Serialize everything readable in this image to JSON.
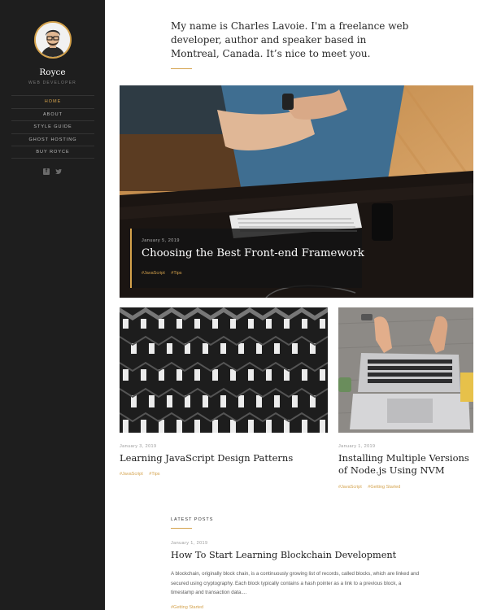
{
  "sidebar": {
    "site_name": "Royce",
    "site_description": "WEB DEVELOPER",
    "nav": [
      {
        "label": "HOME"
      },
      {
        "label": "ABOUT"
      },
      {
        "label": "STYLE GUIDE"
      },
      {
        "label": "GHOST HOSTING"
      },
      {
        "label": "BUY ROYCE"
      }
    ],
    "social": [
      "facebook-icon",
      "twitter-icon"
    ]
  },
  "intro": {
    "text": "My name is Charles Lavoie. I'm a freelance web developer, author and speaker based in Montreal, Canada. It’s nice to meet you."
  },
  "featured": {
    "date": "January 5, 2019",
    "title": "Choosing the Best Front-end Framework",
    "tags": [
      "#JavaScript",
      "#Tips"
    ]
  },
  "posts": [
    {
      "date": "January 3, 2019",
      "title": "Learning JavaScript Design Patterns",
      "tags": [
        "#JavaScript",
        "#Tips"
      ]
    },
    {
      "date": "January 1, 2019",
      "title": "Installing Multiple Versions of Node.js Using NVM",
      "tags": [
        "#JavaScript",
        "#Getting Started"
      ]
    }
  ],
  "latest": {
    "label": "LATEST POSTS",
    "date": "January 1, 2019",
    "title": "How To Start Learning Blockchain Development",
    "excerpt": "A blockchain, originally block chain, is a continuously growing list of records, called blocks, which are linked and secured using cryptography. Each block typically contains a hash pointer as a link to a previous block, a timestamp and transaction data....",
    "tag": "#Getting Started"
  },
  "colors": {
    "accent": "#d4a24c",
    "sidebar_bg": "#1e1e1e"
  }
}
